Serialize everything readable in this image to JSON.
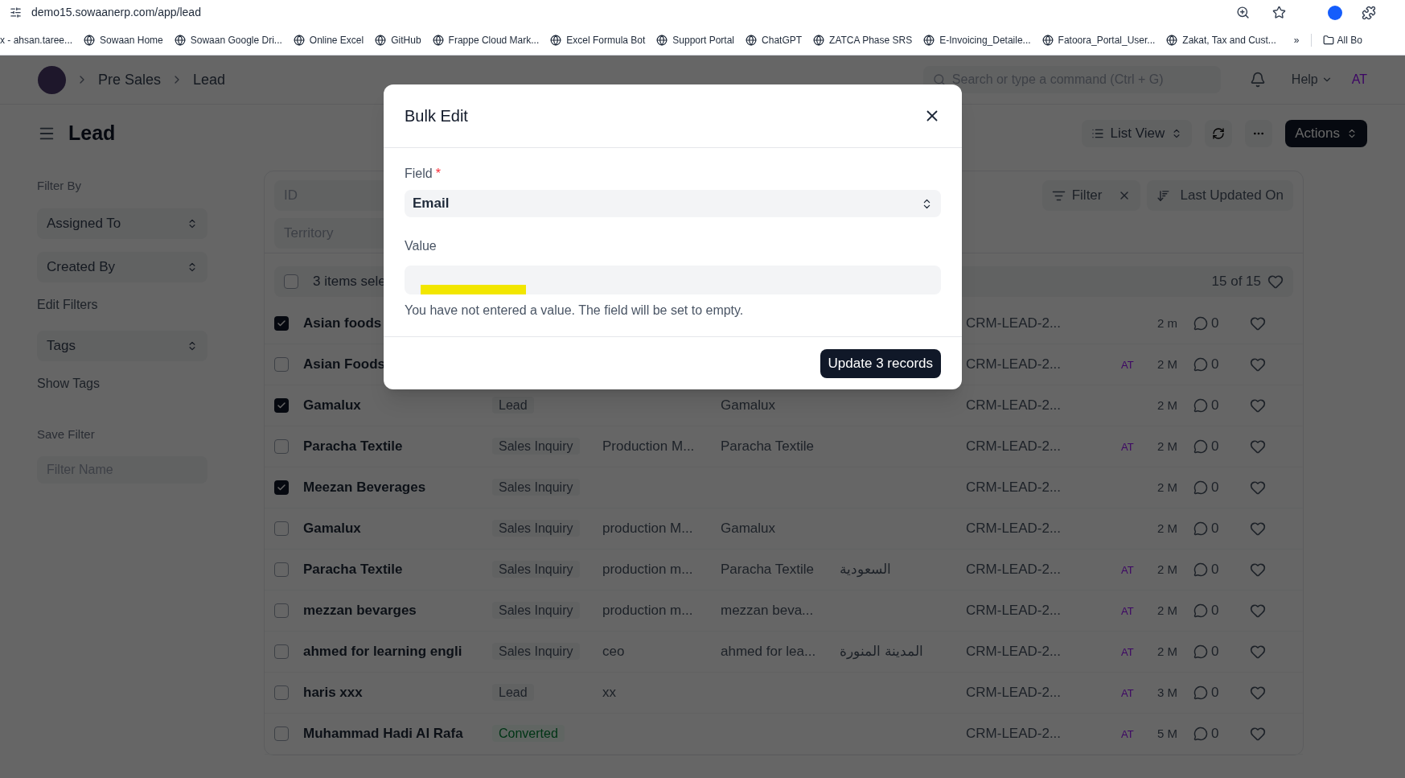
{
  "browser": {
    "url": "demo15.sowaanerp.com/app/lead",
    "bookmarks": [
      "x - ahsan.taree...",
      "Sowaan Home",
      "Sowaan Google Dri...",
      "Online Excel",
      "GitHub",
      "Frappe Cloud Mark...",
      "Excel Formula Bot",
      "Support Portal",
      "ChatGPT",
      "ZATCA Phase SRS",
      "E-Invoicing_Detaile...",
      "Fatoora_Portal_User...",
      "Zakat, Tax and Cust..."
    ],
    "more": "»",
    "all_bookmarks": "All Bo"
  },
  "header": {
    "breadcrumbs": [
      "Pre Sales",
      "Lead"
    ],
    "search": {
      "placeholder": "Search or type a command (Ctrl + G)"
    },
    "help": "Help",
    "avatar": "AT"
  },
  "page": {
    "title": "Lead",
    "view": "List View",
    "actions": "Actions"
  },
  "sidebar": {
    "filter_by": "Filter By",
    "selects": [
      "Assigned To",
      "Created By"
    ],
    "edit_filters": "Edit Filters",
    "tags": "Tags",
    "show_tags": "Show Tags",
    "save_filter": "Save Filter",
    "filter_name": {
      "placeholder": "Filter Name"
    }
  },
  "list": {
    "id_filter": {
      "placeholder": "ID"
    },
    "territory_filter": {
      "placeholder": "Territory"
    },
    "filter": "Filter",
    "sort": "Last Updated On",
    "selected_label": "3 items sele",
    "all_selected": false,
    "count": "15 of 15",
    "rows": [
      {
        "checked": true,
        "name": "Asian foods",
        "id": "CRM-LEAD-2...",
        "time": "2 m",
        "comments": "0"
      },
      {
        "checked": false,
        "name": "Asian Foods",
        "id": "CRM-LEAD-2...",
        "assigned": "AT",
        "time": "2 M",
        "comments": "0"
      },
      {
        "checked": true,
        "name": "Gamalux",
        "status": {
          "label": "Lead",
          "kind": "plain"
        },
        "col4": "Gamalux",
        "id": "CRM-LEAD-2...",
        "time": "2 M",
        "comments": "0"
      },
      {
        "checked": false,
        "name": "Paracha Textile",
        "status": {
          "label": "Sales Inquiry",
          "kind": "plain"
        },
        "col3": "Production M...",
        "col4": "Paracha Textile",
        "id": "CRM-LEAD-2...",
        "assigned": "AT",
        "time": "2 M",
        "comments": "0"
      },
      {
        "checked": true,
        "name": "Meezan Beverages",
        "status": {
          "label": "Sales Inquiry",
          "kind": "plain"
        },
        "id": "CRM-LEAD-2...",
        "time": "2 M",
        "comments": "0"
      },
      {
        "checked": false,
        "name": "Gamalux",
        "status": {
          "label": "Sales Inquiry",
          "kind": "plain"
        },
        "col3": "production M...",
        "col4": "Gamalux",
        "id": "CRM-LEAD-2...",
        "time": "2 M",
        "comments": "0"
      },
      {
        "checked": false,
        "name": "Paracha Textile",
        "status": {
          "label": "Sales Inquiry",
          "kind": "plain"
        },
        "col3": "production m...",
        "col4": "Paracha Textile",
        "col5": "السعودية",
        "id": "CRM-LEAD-2...",
        "assigned": "AT",
        "time": "2 M",
        "comments": "0"
      },
      {
        "checked": false,
        "name": "mezzan bevarges",
        "status": {
          "label": "Sales Inquiry",
          "kind": "plain"
        },
        "col3": "production m...",
        "col4": "mezzan beva...",
        "id": "CRM-LEAD-2...",
        "assigned": "AT",
        "time": "2 M",
        "comments": "0"
      },
      {
        "checked": false,
        "name": "ahmed for learning engli",
        "status": {
          "label": "Sales Inquiry",
          "kind": "plain"
        },
        "col3": "ceo",
        "col4": "ahmed for lea...",
        "col5": "المدينة المنورة",
        "id": "CRM-LEAD-2...",
        "assigned": "AT",
        "time": "2 M",
        "comments": "0"
      },
      {
        "checked": false,
        "name": "haris xxx",
        "status": {
          "label": "Lead",
          "kind": "plain"
        },
        "col3": "xx",
        "id": "CRM-LEAD-2...",
        "assigned": "AT",
        "time": "3 M",
        "comments": "0"
      },
      {
        "checked": false,
        "name": "Muhammad Hadi Al Rafa",
        "status": {
          "label": "Converted",
          "kind": "success"
        },
        "id": "CRM-LEAD-2...",
        "assigned": "AT",
        "time": "5 M",
        "comments": "0"
      }
    ]
  },
  "dialog": {
    "title": "Bulk Edit",
    "field_label": "Field",
    "required": "*",
    "field_value": "Email",
    "value_label": "Value",
    "hint": "You have not entered a value. The field will be set to empty.",
    "submit": "Update 3 records"
  }
}
